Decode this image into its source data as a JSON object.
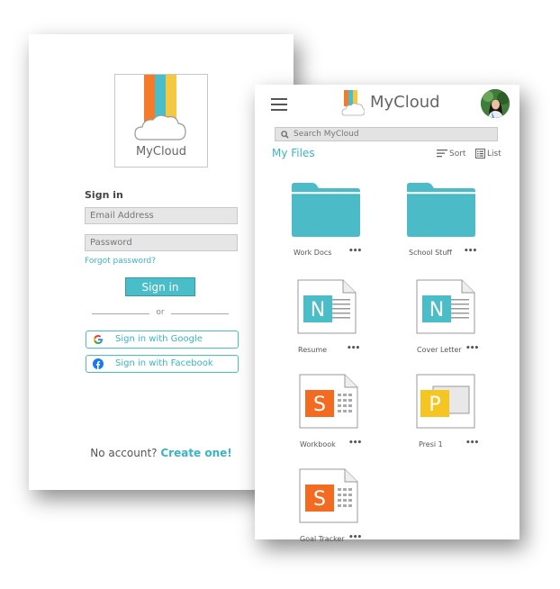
{
  "signin": {
    "logo_label": "MyCloud",
    "heading": "Sign in",
    "email_placeholder": "Email Address",
    "password_placeholder": "Password",
    "forgot": "Forgot password?",
    "signin_button": "Sign in",
    "or": "or",
    "google_button": "Sign in with Google",
    "facebook_button": "Sign in with Facebook",
    "no_account": "No account?",
    "create_one": "Create one!"
  },
  "files": {
    "title": "MyCloud",
    "search_placeholder": "Search MyCloud",
    "section_title": "My Files",
    "sort_label": "Sort",
    "list_label": "List",
    "items": [
      {
        "name": "Work Docs",
        "type": "folder",
        "more": "•••"
      },
      {
        "name": "School Stuff",
        "type": "folder",
        "more": "•••"
      },
      {
        "name": "Resume",
        "type": "notes",
        "letter": "N",
        "more": "•••"
      },
      {
        "name": "Cover Letter",
        "type": "notes",
        "letter": "N",
        "more": "•••"
      },
      {
        "name": "Workbook",
        "type": "sheet",
        "letter": "S",
        "more": "•••"
      },
      {
        "name": "Presi 1",
        "type": "presentation",
        "letter": "P",
        "more": "•••"
      },
      {
        "name": "Goal Tracker",
        "type": "sheet",
        "letter": "S",
        "more": "•••"
      }
    ]
  },
  "colors": {
    "accent": "#49bdc8",
    "logo_orange": "#f47b2a",
    "logo_teal": "#49bdc8",
    "logo_yellow": "#f5c842",
    "sheet_orange": "#f26b21",
    "pres_yellow": "#f5c522",
    "folder": "#4bbcc7"
  }
}
